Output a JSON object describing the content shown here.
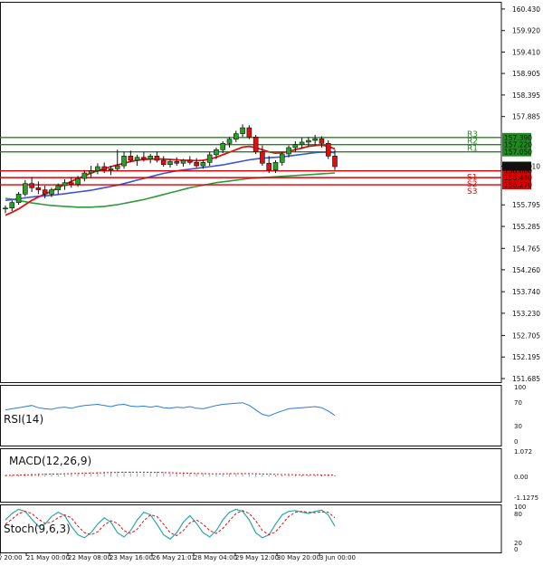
{
  "chart_data": {
    "type": "candlestick",
    "price_axis": {
      "ticks": [
        "160.430",
        "159.920",
        "159.410",
        "158.905",
        "158.395",
        "157.885",
        "156.710",
        "155.795",
        "155.285",
        "154.765",
        "154.260",
        "153.740",
        "153.230",
        "152.705",
        "152.195",
        "151.685"
      ],
      "ylim": [
        151.6,
        160.6
      ],
      "current_price": "156.710",
      "current_price_value": 156.71
    },
    "levels": [
      {
        "label": "R3",
        "price_label": "157.390",
        "value": 157.39,
        "color": "#1f8a1f"
      },
      {
        "label": "R2",
        "price_label": "157.220",
        "value": 157.22,
        "color": "#1f8a1f"
      },
      {
        "label": "R1",
        "price_label": "157.050",
        "value": 157.05,
        "color": "#1f8a1f"
      },
      {
        "label": "S1",
        "price_label": "156.600",
        "value": 156.6,
        "color": "#e00000"
      },
      {
        "label": "S2",
        "price_label": "156.440",
        "value": 156.44,
        "color": "#e00000"
      },
      {
        "label": "S3",
        "price_label": "156.270",
        "value": 156.27,
        "color": "#e00000"
      }
    ],
    "x_labels": [
      "y 20:00",
      "21 May 00:00",
      "22 May 08:00",
      "23 May 16:00",
      "26 May 21:01",
      "28 May 04:00",
      "29 May 12:00",
      "30 May 20:00",
      "3 Jun 00:00"
    ],
    "candles": [
      [
        155.7,
        155.78,
        155.6,
        155.72
      ],
      [
        155.72,
        155.9,
        155.65,
        155.85
      ],
      [
        155.85,
        156.1,
        155.8,
        156.05
      ],
      [
        156.05,
        156.38,
        156.0,
        156.3
      ],
      [
        156.3,
        156.45,
        156.1,
        156.2
      ],
      [
        156.2,
        156.35,
        156.05,
        156.15
      ],
      [
        156.15,
        156.25,
        155.95,
        156.05
      ],
      [
        156.05,
        156.2,
        155.98,
        156.15
      ],
      [
        156.15,
        156.3,
        156.05,
        156.25
      ],
      [
        156.25,
        156.4,
        156.15,
        156.32
      ],
      [
        156.32,
        156.45,
        156.2,
        156.28
      ],
      [
        156.28,
        156.48,
        156.22,
        156.42
      ],
      [
        156.42,
        156.62,
        156.35,
        156.55
      ],
      [
        156.55,
        156.72,
        156.45,
        156.6
      ],
      [
        156.6,
        156.78,
        156.52,
        156.7
      ],
      [
        156.7,
        156.8,
        156.55,
        156.62
      ],
      [
        156.62,
        156.72,
        156.5,
        156.65
      ],
      [
        156.65,
        157.1,
        156.6,
        156.72
      ],
      [
        156.72,
        157.05,
        156.65,
        156.95
      ],
      [
        156.95,
        157.08,
        156.8,
        156.85
      ],
      [
        156.85,
        156.98,
        156.72,
        156.92
      ],
      [
        156.92,
        157.05,
        156.82,
        156.88
      ],
      [
        156.88,
        157.0,
        156.78,
        156.95
      ],
      [
        156.95,
        157.05,
        156.8,
        156.85
      ],
      [
        156.85,
        156.95,
        156.7,
        156.75
      ],
      [
        156.75,
        156.88,
        156.68,
        156.82
      ],
      [
        156.82,
        156.92,
        156.72,
        156.78
      ],
      [
        156.78,
        156.88,
        156.7,
        156.85
      ],
      [
        156.85,
        156.95,
        156.75,
        156.8
      ],
      [
        156.8,
        156.9,
        156.68,
        156.72
      ],
      [
        156.72,
        156.85,
        156.65,
        156.8
      ],
      [
        156.8,
        157.05,
        156.72,
        156.98
      ],
      [
        156.98,
        157.15,
        156.88,
        157.1
      ],
      [
        157.1,
        157.3,
        157.02,
        157.25
      ],
      [
        157.25,
        157.4,
        157.15,
        157.35
      ],
      [
        157.35,
        157.55,
        157.28,
        157.48
      ],
      [
        157.48,
        157.7,
        157.4,
        157.62
      ],
      [
        157.62,
        157.68,
        157.35,
        157.4
      ],
      [
        157.4,
        157.45,
        157.0,
        157.05
      ],
      [
        157.05,
        157.2,
        156.72,
        156.78
      ],
      [
        156.78,
        156.95,
        156.55,
        156.62
      ],
      [
        156.62,
        156.85,
        156.55,
        156.8
      ],
      [
        156.8,
        157.05,
        156.72,
        157.0
      ],
      [
        157.0,
        157.2,
        156.92,
        157.15
      ],
      [
        157.15,
        157.3,
        157.05,
        157.22
      ],
      [
        157.22,
        157.38,
        157.12,
        157.28
      ],
      [
        157.28,
        157.4,
        157.18,
        157.32
      ],
      [
        157.32,
        157.45,
        157.2,
        157.36
      ],
      [
        157.36,
        157.42,
        157.15,
        157.25
      ],
      [
        157.25,
        157.32,
        156.88,
        156.95
      ],
      [
        156.95,
        157.1,
        156.62,
        156.7
      ]
    ],
    "sma_fast": [
      155.55,
      155.62,
      155.7,
      155.8,
      155.9,
      155.98,
      156.05,
      156.12,
      156.2,
      156.28,
      156.35,
      156.42,
      156.48,
      156.55,
      156.6,
      156.65,
      156.7,
      156.74,
      156.78,
      156.82,
      156.85,
      156.87,
      156.88,
      156.88,
      156.88,
      156.87,
      156.86,
      156.85,
      156.85,
      156.84,
      156.85,
      156.88,
      156.92,
      156.98,
      157.04,
      157.1,
      157.16,
      157.18,
      157.15,
      157.1,
      157.05,
      157.02,
      157.03,
      157.06,
      157.1,
      157.14,
      157.18,
      157.2,
      157.21,
      157.18,
      157.12
    ],
    "sma_mid": [
      155.9,
      155.92,
      155.94,
      155.96,
      155.98,
      156.0,
      156.01,
      156.02,
      156.04,
      156.06,
      156.08,
      156.1,
      156.12,
      156.14,
      156.17,
      156.2,
      156.23,
      156.26,
      156.3,
      156.34,
      156.38,
      156.42,
      156.46,
      156.5,
      156.54,
      156.57,
      156.6,
      156.62,
      156.64,
      156.66,
      156.68,
      156.7,
      156.72,
      156.74,
      156.77,
      156.8,
      156.83,
      156.86,
      156.88,
      156.9,
      156.91,
      156.92,
      156.93,
      156.95,
      156.97,
      156.99,
      157.01,
      157.03,
      157.04,
      157.04,
      157.03
    ],
    "sma_slow": [
      155.95,
      155.93,
      155.9,
      155.87,
      155.84,
      155.82,
      155.8,
      155.78,
      155.77,
      155.76,
      155.75,
      155.74,
      155.74,
      155.74,
      155.75,
      155.76,
      155.78,
      155.8,
      155.83,
      155.86,
      155.89,
      155.92,
      155.96,
      156.0,
      156.04,
      156.08,
      156.12,
      156.16,
      156.2,
      156.23,
      156.26,
      156.29,
      156.32,
      156.34,
      156.36,
      156.38,
      156.4,
      156.42,
      156.43,
      156.44,
      156.45,
      156.46,
      156.47,
      156.48,
      156.49,
      156.5,
      156.51,
      156.52,
      156.53,
      156.54,
      156.55
    ],
    "rsi": {
      "title": "RSI(14)",
      "ticks": [
        "100",
        "70",
        "30",
        "0"
      ],
      "values": [
        58,
        60,
        62,
        64,
        66,
        62,
        60,
        59,
        62,
        63,
        61,
        64,
        66,
        67,
        68,
        66,
        64,
        67,
        68,
        65,
        64,
        65,
        63,
        65,
        62,
        61,
        63,
        62,
        64,
        61,
        60,
        63,
        66,
        68,
        69,
        70,
        71,
        66,
        58,
        50,
        47,
        52,
        56,
        60,
        61,
        62,
        63,
        64,
        62,
        56,
        48
      ]
    },
    "macd": {
      "title": "MACD(12,26,9)",
      "ticks": [
        "1.072",
        "0.00",
        "-1.1275"
      ],
      "histogram": [
        0.1,
        0.11,
        0.12,
        0.13,
        0.14,
        0.15,
        0.16,
        0.17,
        0.18,
        0.19,
        0.2,
        0.21,
        0.22,
        0.23,
        0.24,
        0.25,
        0.26,
        0.27,
        0.28,
        0.28,
        0.28,
        0.27,
        0.26,
        0.25,
        0.24,
        0.23,
        0.22,
        0.21,
        0.2,
        0.19,
        0.18,
        0.17,
        0.17,
        0.18,
        0.19,
        0.2,
        0.2,
        0.19,
        0.17,
        0.14,
        0.12,
        0.11,
        0.1,
        0.1,
        0.1,
        0.1,
        0.1,
        0.1,
        0.09,
        0.08,
        0.06
      ],
      "signal": [
        0.05,
        0.06,
        0.07,
        0.08,
        0.09,
        0.1,
        0.11,
        0.12,
        0.13,
        0.14,
        0.15,
        0.16,
        0.17,
        0.18,
        0.19,
        0.2,
        0.21,
        0.22,
        0.23,
        0.23,
        0.23,
        0.23,
        0.22,
        0.22,
        0.21,
        0.2,
        0.19,
        0.18,
        0.17,
        0.16,
        0.15,
        0.14,
        0.14,
        0.14,
        0.15,
        0.15,
        0.15,
        0.15,
        0.14,
        0.13,
        0.12,
        0.11,
        0.1,
        0.1,
        0.09,
        0.09,
        0.09,
        0.09,
        0.08,
        0.08,
        0.07
      ]
    },
    "stoch": {
      "title": "Stoch(9,6,3)",
      "ticks": [
        "100",
        "80",
        "20",
        "0"
      ],
      "k": [
        70,
        85,
        95,
        90,
        72,
        55,
        60,
        78,
        88,
        80,
        55,
        35,
        28,
        40,
        60,
        75,
        65,
        40,
        30,
        45,
        70,
        88,
        82,
        60,
        35,
        25,
        40,
        65,
        80,
        62,
        40,
        30,
        45,
        70,
        88,
        95,
        90,
        70,
        40,
        28,
        35,
        60,
        82,
        90,
        92,
        88,
        85,
        90,
        93,
        82,
        55
      ],
      "d": [
        60,
        72,
        85,
        90,
        85,
        72,
        62,
        65,
        75,
        82,
        75,
        55,
        40,
        35,
        42,
        58,
        68,
        62,
        45,
        38,
        48,
        68,
        82,
        78,
        60,
        40,
        33,
        45,
        63,
        70,
        60,
        45,
        38,
        50,
        68,
        85,
        92,
        85,
        68,
        45,
        35,
        42,
        60,
        78,
        88,
        90,
        88,
        87,
        89,
        88,
        75
      ]
    }
  }
}
